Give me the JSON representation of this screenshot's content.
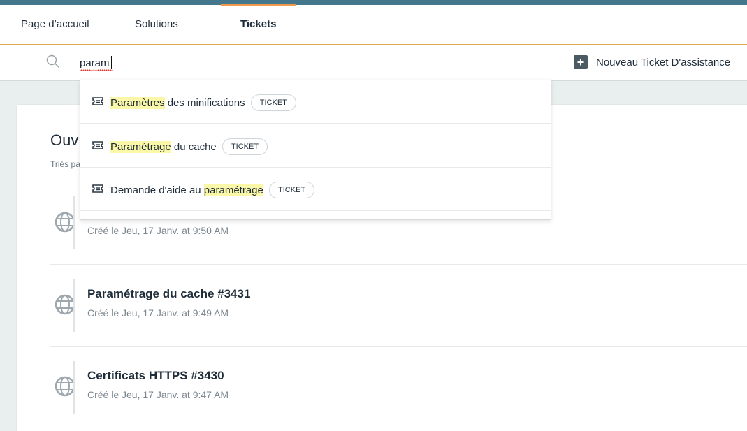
{
  "nav": {
    "tabs": [
      {
        "label": "Page d’accueil",
        "active": false
      },
      {
        "label": "Solutions",
        "active": false
      },
      {
        "label": "Tickets",
        "active": true
      }
    ]
  },
  "search": {
    "value": "param",
    "placeholder": ""
  },
  "actions": {
    "new_ticket_label": "Nouveau Ticket D'assistance"
  },
  "card": {
    "title": "Ouv",
    "subtitle": "Triés pa"
  },
  "tickets": [
    {
      "title": "",
      "created": "Créé le Jeu, 17 Janv. at 9:50 AM"
    },
    {
      "title": "Paramétrage du cache #3431",
      "created": "Créé le Jeu, 17 Janv. at 9:49 AM"
    },
    {
      "title": "Certificats HTTPS #3430",
      "created": "Créé le Jeu, 17 Janv. at 9:47 AM"
    }
  ],
  "suggestions": [
    {
      "before": "",
      "match": "Paramètres",
      "after": " des minifications",
      "badge": "TICKET"
    },
    {
      "before": "",
      "match": "Paramétrage",
      "after": " du cache",
      "badge": "TICKET"
    },
    {
      "before": "Demande d'aide au ",
      "match": "paramétrage",
      "after": "",
      "badge": "TICKET"
    }
  ],
  "colors": {
    "topbar": "#44778c",
    "active_tab_underline": "#f2984b",
    "highlight": "#fbf7a8"
  }
}
